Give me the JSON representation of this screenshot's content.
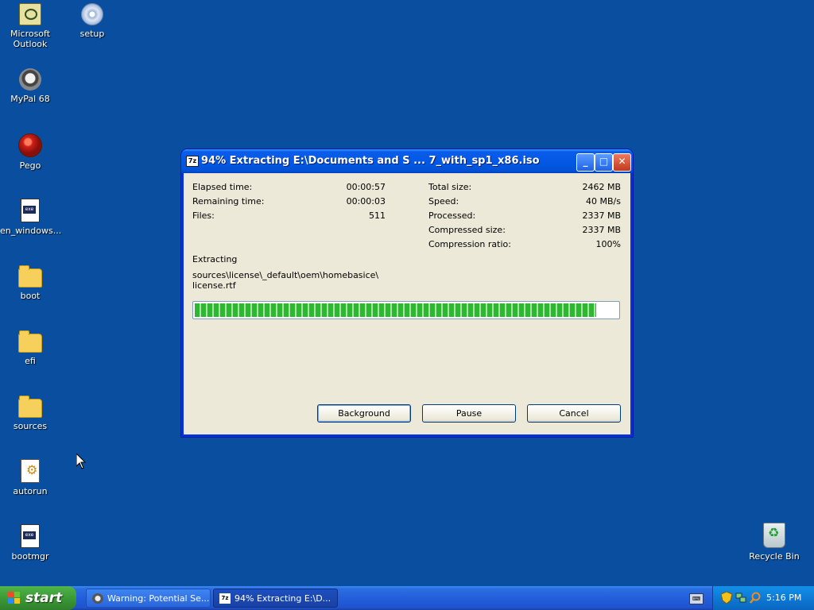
{
  "desktop": {
    "icons": [
      {
        "label_line1": "Microsoft",
        "label_line2": "Outlook",
        "icon": "outlook-icon"
      },
      {
        "label_line1": "setup",
        "label_line2": "",
        "icon": "cd-setup-icon"
      },
      {
        "label_line1": "MyPal 68",
        "label_line2": "",
        "icon": "mypal-icon"
      },
      {
        "label_line1": "Pego",
        "label_line2": "",
        "icon": "pego-icon"
      },
      {
        "label_line1": "en_windows...",
        "label_line2": "",
        "icon": "executable-file-icon"
      },
      {
        "label_line1": "boot",
        "label_line2": "",
        "icon": "folder-icon"
      },
      {
        "label_line1": "efi",
        "label_line2": "",
        "icon": "folder-icon"
      },
      {
        "label_line1": "sources",
        "label_line2": "",
        "icon": "folder-icon"
      },
      {
        "label_line1": "autorun",
        "label_line2": "",
        "icon": "autorun-icon"
      },
      {
        "label_line1": "bootmgr",
        "label_line2": "",
        "icon": "executable-file-icon"
      },
      {
        "label_line1": "Recycle Bin",
        "label_line2": "",
        "icon": "recycle-bin-icon"
      }
    ]
  },
  "window": {
    "app_icon_text": "7z",
    "title": "94% Extracting E:\\Documents and S ... 7_with_sp1_x86.iso",
    "minimize": "_",
    "maximize": "□",
    "close": "✕",
    "stats_left": [
      {
        "label": "Elapsed time:",
        "value": "00:00:57"
      },
      {
        "label": "Remaining time:",
        "value": "00:00:03"
      },
      {
        "label": "Files:",
        "value": "511"
      }
    ],
    "stats_right": [
      {
        "label": "Total size:",
        "value": "2462 MB"
      },
      {
        "label": "Speed:",
        "value": "40 MB/s"
      },
      {
        "label": "Processed:",
        "value": "2337 MB"
      },
      {
        "label": "Compressed size:",
        "value": "2337 MB"
      },
      {
        "label": "Compression ratio:",
        "value": "100%"
      }
    ],
    "operation": "Extracting",
    "current_file_line1": "sources\\license\\_default\\oem\\homebasice\\",
    "current_file_line2": "license.rtf",
    "progress_fraction": 0.95,
    "buttons": {
      "background": "Background",
      "pause": "Pause",
      "cancel": "Cancel"
    }
  },
  "taskbar": {
    "start_label": "start",
    "tasks": [
      {
        "label": "Warning: Potential Se...",
        "active": false
      },
      {
        "label": "94% Extracting E:\\D...",
        "active": true
      }
    ],
    "clock": "5:16 PM"
  },
  "colors": {
    "desktop": "#0a4e9f",
    "title_bar": "#0358e6",
    "progress_fill": "#2fb82f",
    "taskbar": "#245edb",
    "start_button": "#3c9a36",
    "tray": "#0d7ad6"
  }
}
